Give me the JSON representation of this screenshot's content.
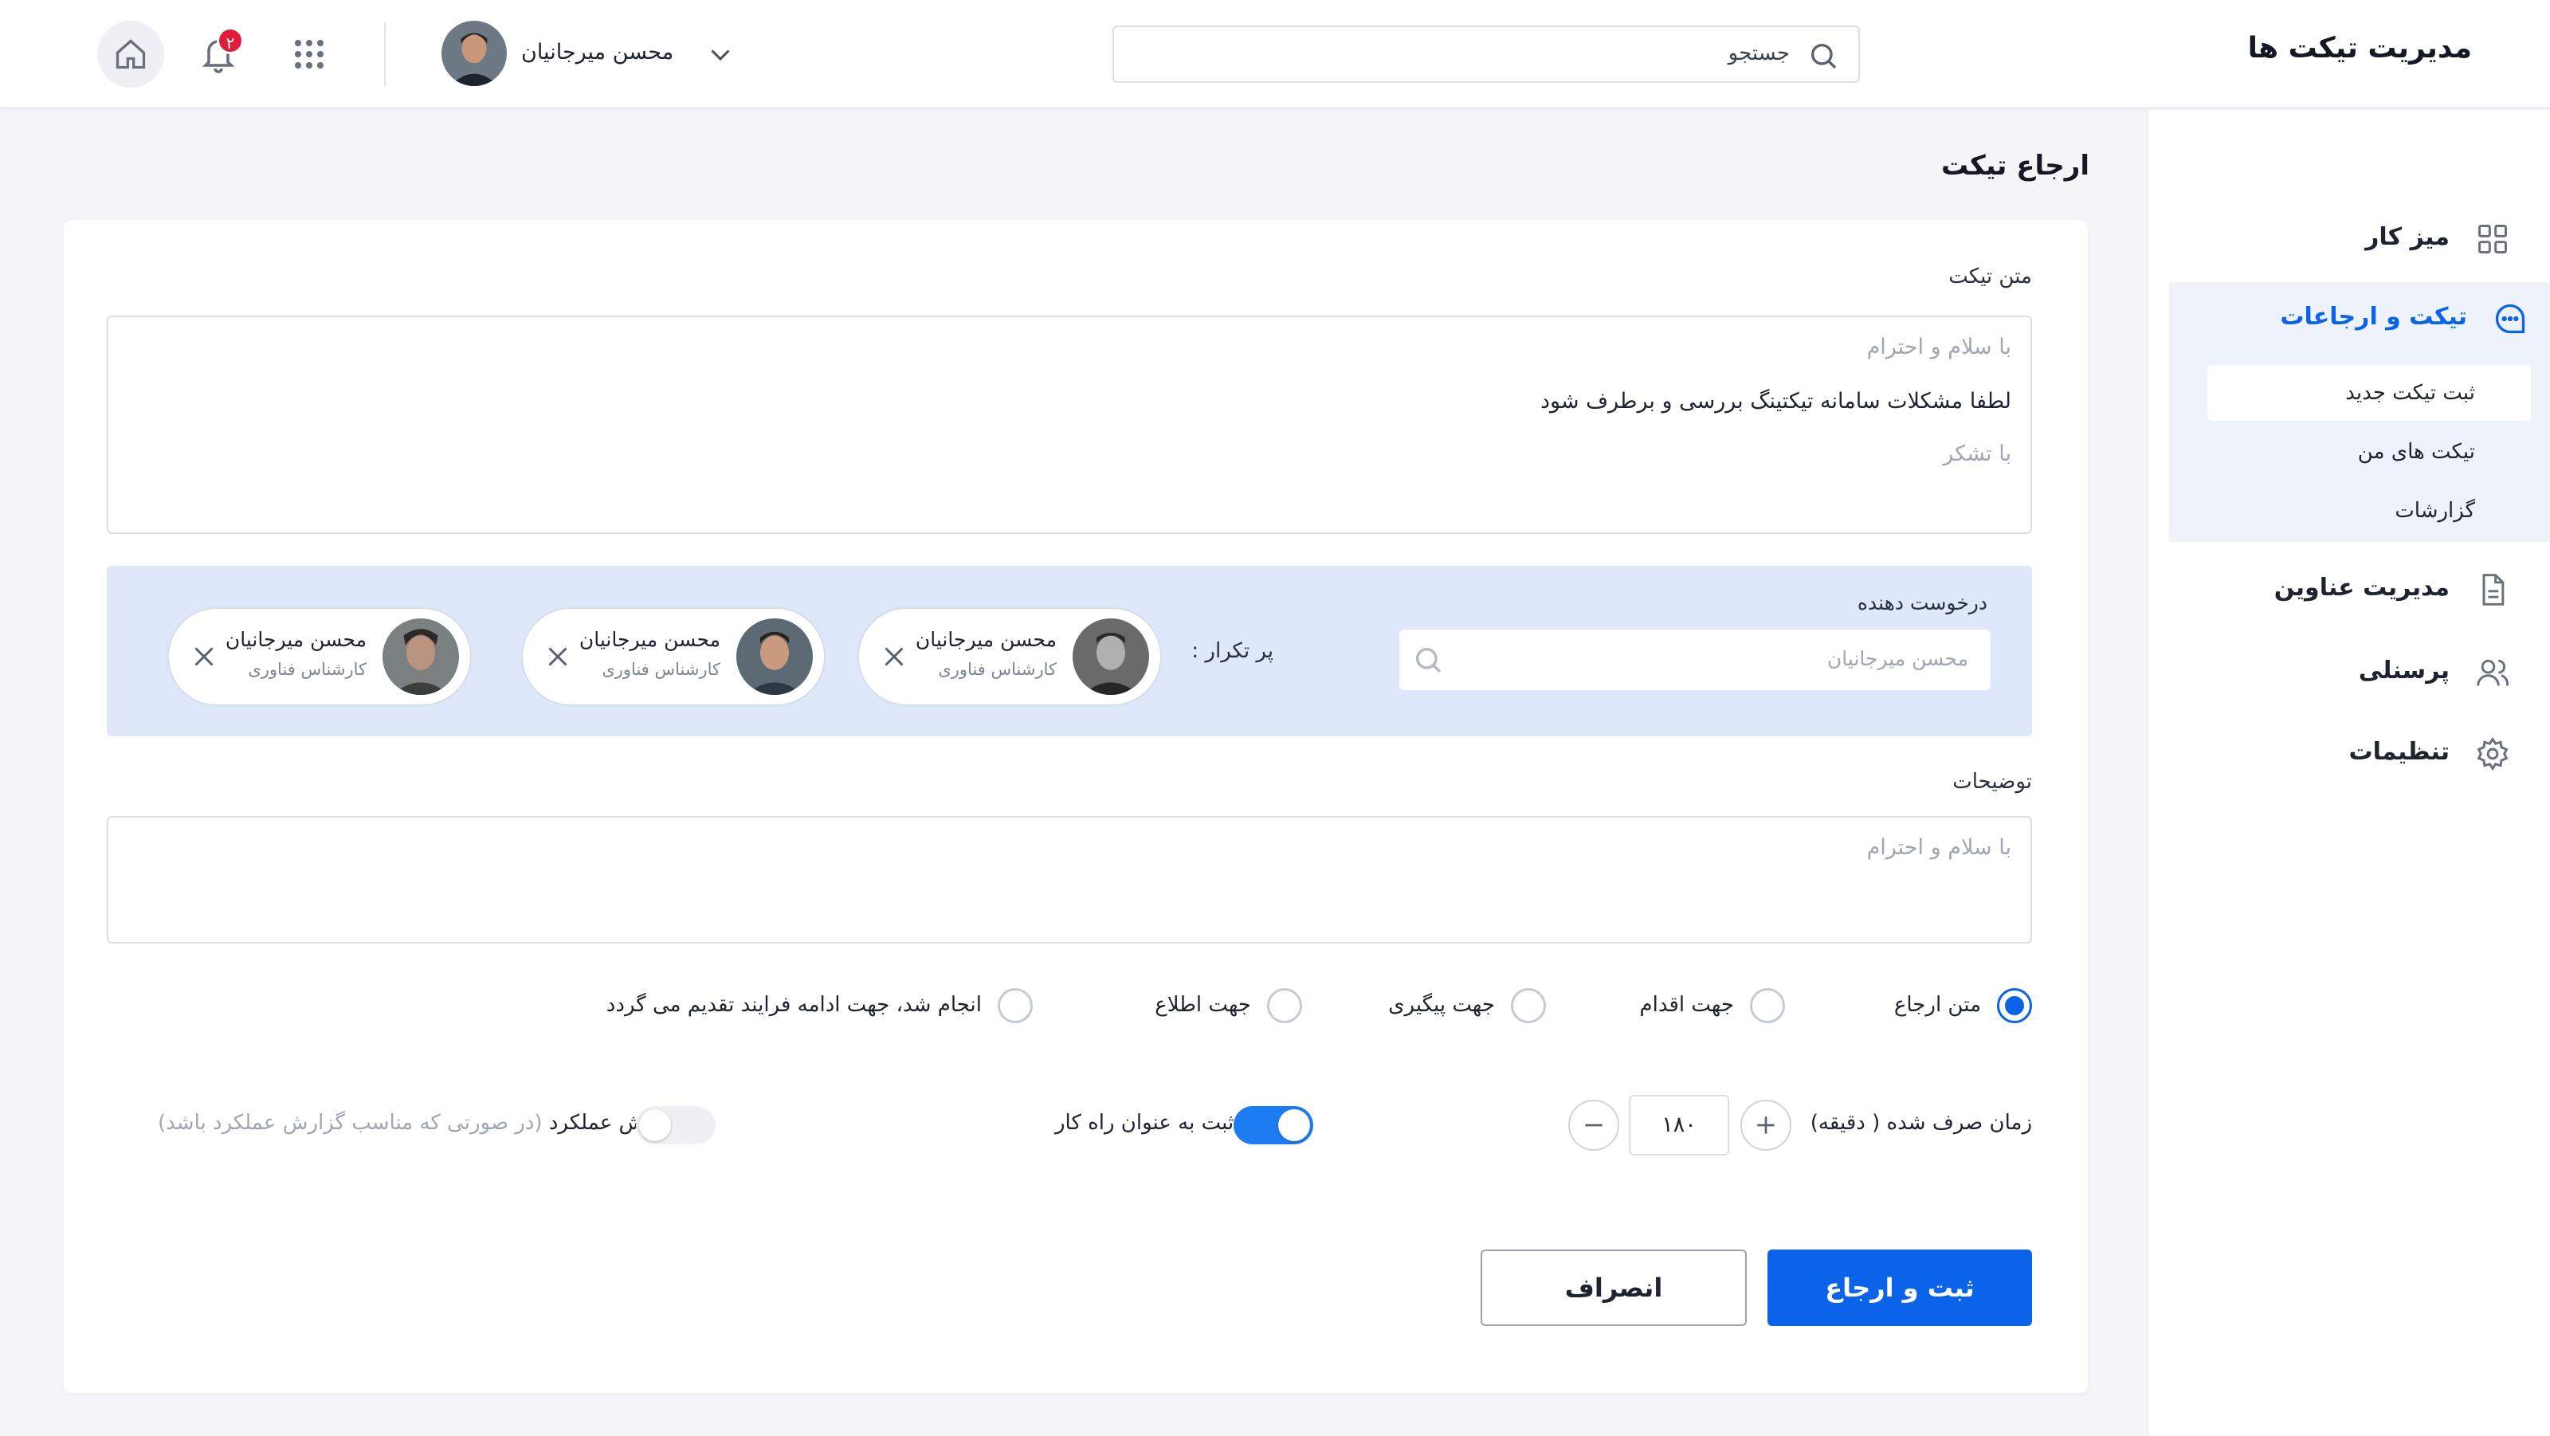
{
  "app": {
    "title": "مدیریت تیکت ها"
  },
  "header": {
    "search_placeholder": "جستجو",
    "user_name": "محسن میرجانیان",
    "notification_count": "۲"
  },
  "sidebar": {
    "items": [
      {
        "label": "میز کار",
        "icon": "grid-icon"
      },
      {
        "label": "تیکت و ارجاعات",
        "icon": "chat-icon",
        "active": true,
        "children": [
          {
            "label": "ثبت تیکت جدید",
            "active": true
          },
          {
            "label": "تیکت های من"
          },
          {
            "label": "گزارشات"
          }
        ]
      },
      {
        "label": "مدیریت عناوین",
        "icon": "document-icon"
      },
      {
        "label": "پرسنلی",
        "icon": "users-icon"
      },
      {
        "label": "تنظیمات",
        "icon": "gear-icon"
      }
    ]
  },
  "page": {
    "title": "ارجاع تیکت"
  },
  "form": {
    "ticket_text_label": "متن تیکت",
    "ticket_text": {
      "greeting": "با سلام و احترام",
      "body": "لطفا مشکلات سامانه تیکتینگ بررسی و برطرف شود",
      "closing": "با تشکر"
    },
    "requester": {
      "label": "درخوست دهنده",
      "placeholder": "محسن میرجانیان",
      "frequent_label": "پر تکرار :",
      "chips": [
        {
          "name": "محسن میرجانیان",
          "role": "کارشناس فناوری"
        },
        {
          "name": "محسن میرجانیان",
          "role": "کارشناس فناوری"
        },
        {
          "name": "محسن میرجانیان",
          "role": "کارشناس فناوری"
        }
      ]
    },
    "description_label": "توضیحات",
    "description_placeholder": "با سلام و احترام",
    "referral_options": [
      {
        "label": "متن ارجاع",
        "checked": true
      },
      {
        "label": "جهت اقدام",
        "checked": false
      },
      {
        "label": "جهت پیگیری",
        "checked": false
      },
      {
        "label": "جهت اطلاع",
        "checked": false
      },
      {
        "label": "انجام شد، جهت ادامه فرایند تقدیم می گردد",
        "checked": false
      }
    ],
    "time_spent_label": "زمان صرف شده ( دقیقه)",
    "time_spent_value": "۱۸۰",
    "solution_toggle": {
      "label": "ثبت به عنوان راه کار",
      "on": true
    },
    "report_toggle": {
      "label": "گزارش عملکرد",
      "hint": "(در صورتی که مناسب گزارش عملکرد باشد)",
      "on": false
    },
    "submit_label": "ثبت و ارجاع",
    "cancel_label": "انصراف"
  },
  "colors": {
    "accent": "#0a63e8",
    "panel": "#dfe8fb",
    "badge": "#e01e3c"
  }
}
